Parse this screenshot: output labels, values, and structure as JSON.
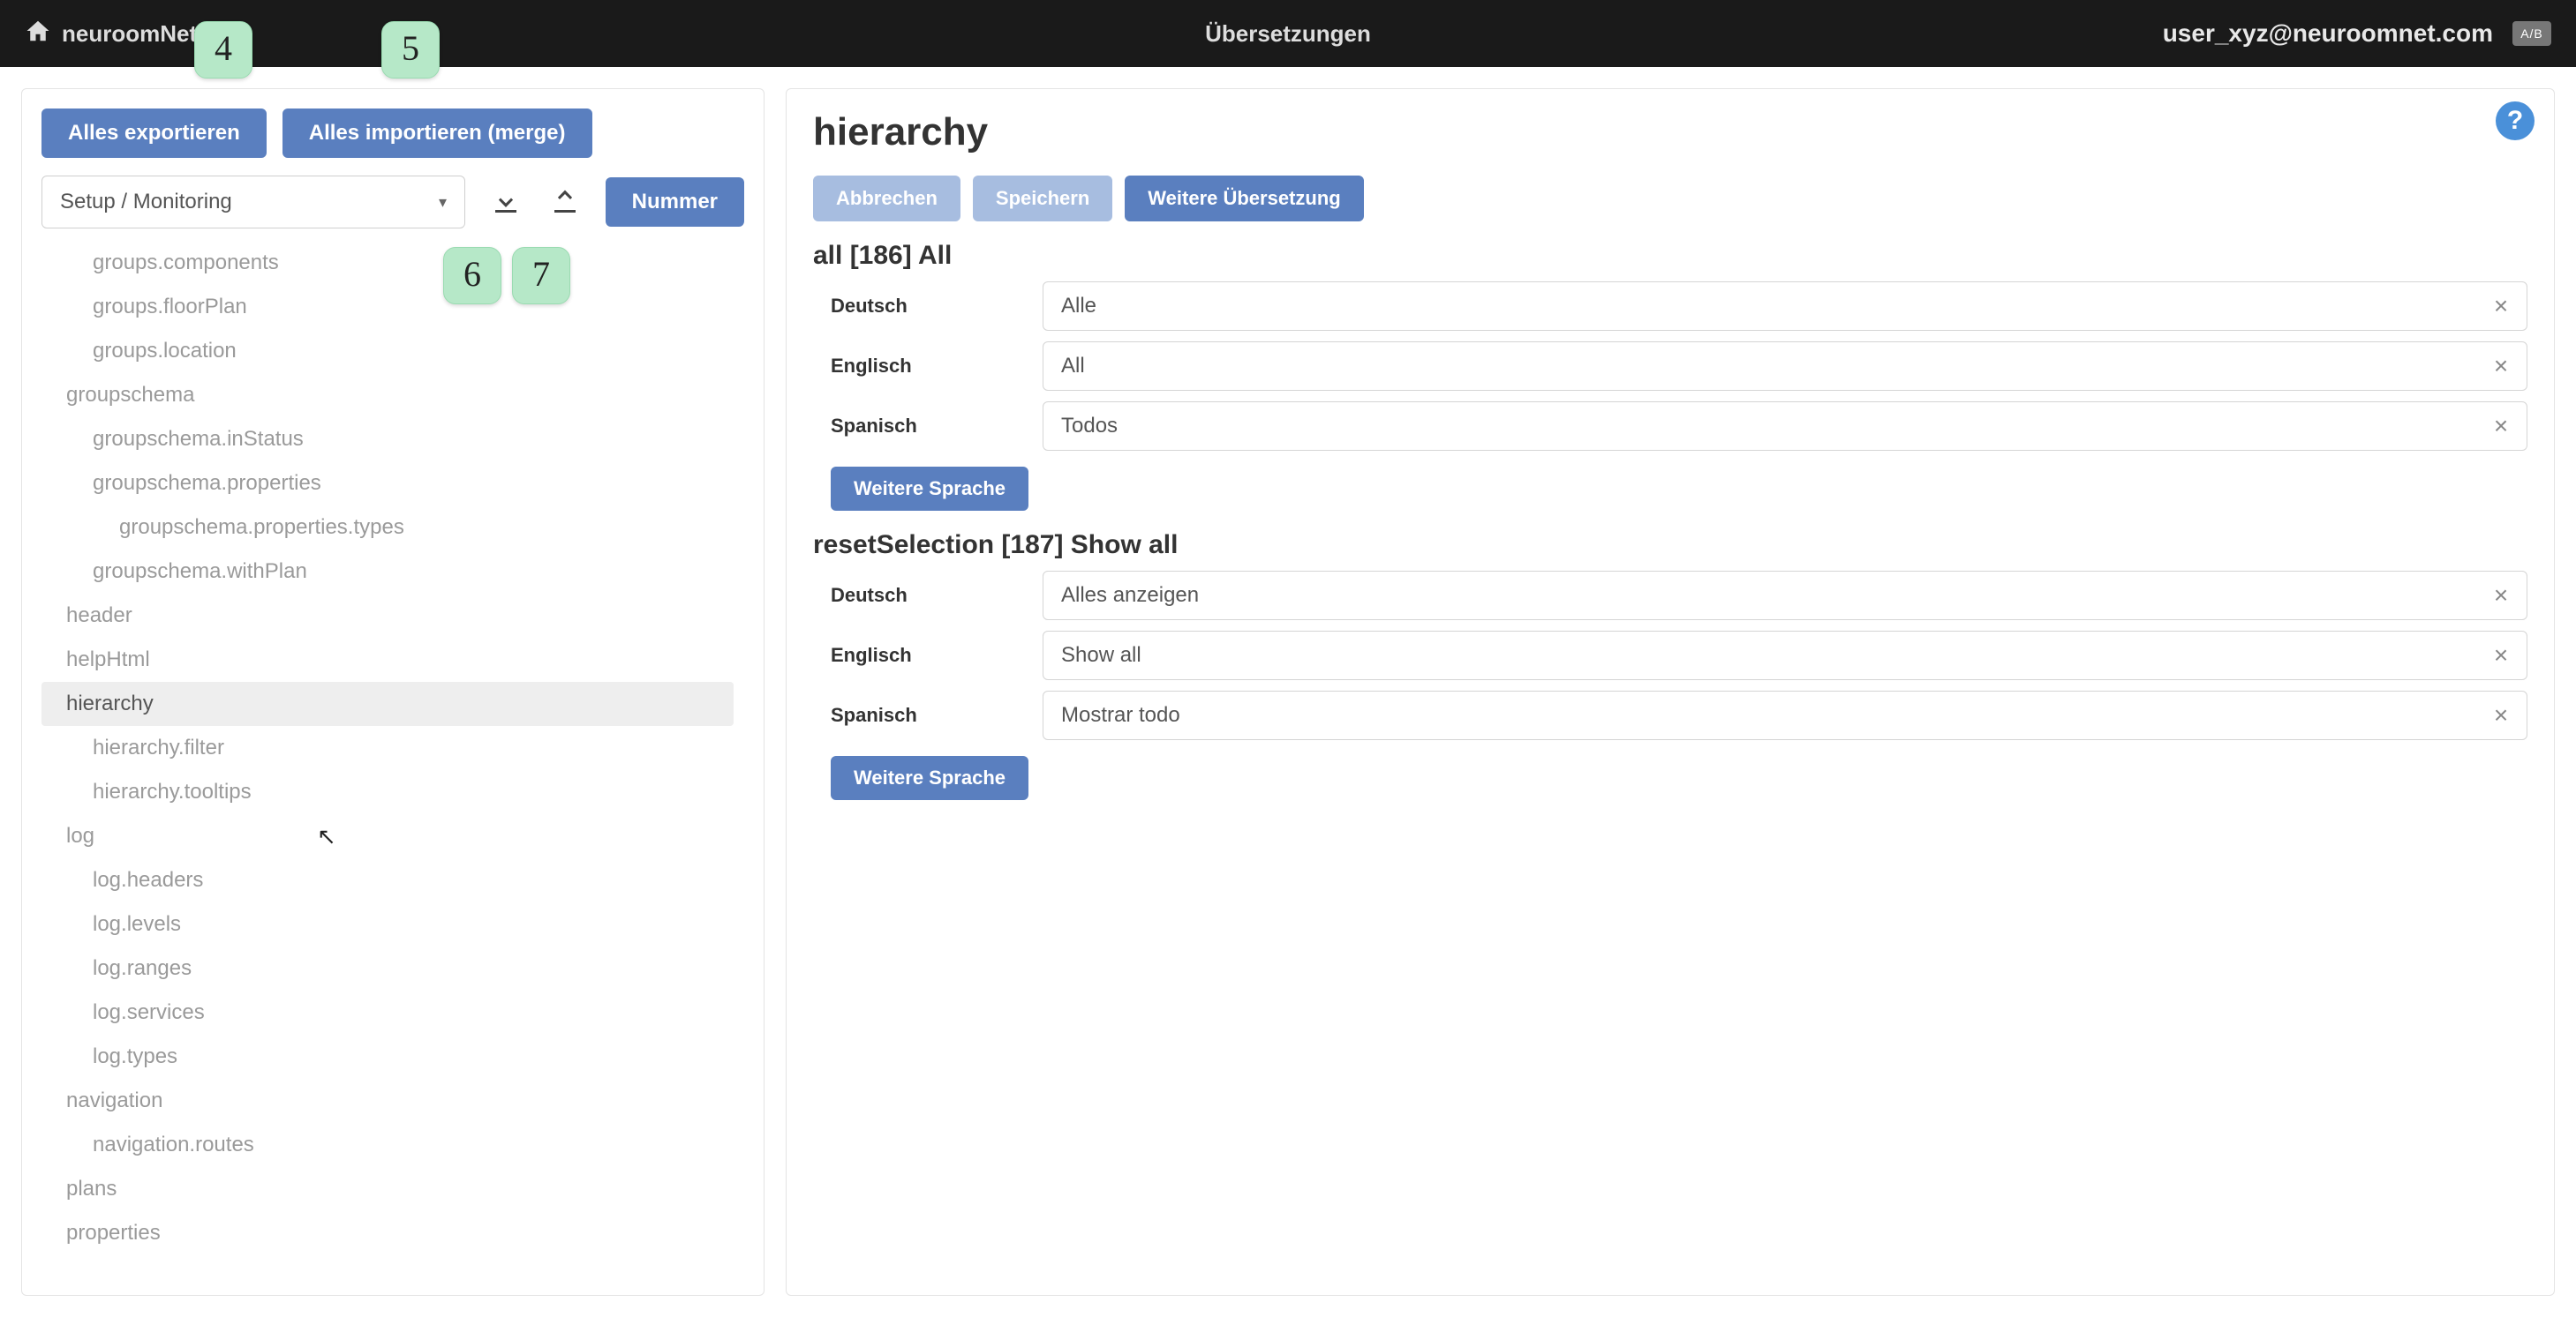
{
  "topbar": {
    "brand": "neuroomNet",
    "page_title": "Übersetzungen",
    "user_email": "user_xyz@neuroomnet.com",
    "lang_badge": "A/B"
  },
  "left": {
    "export_all": "Alles exportieren",
    "import_all": "Alles importieren (merge)",
    "dropdown_value": "Setup / Monitoring",
    "number_btn": "Nummer",
    "tree": [
      {
        "label": "groups.components",
        "level": 1,
        "active": false
      },
      {
        "label": "groups.floorPlan",
        "level": 1,
        "active": false
      },
      {
        "label": "groups.location",
        "level": 1,
        "active": false
      },
      {
        "label": "groupschema",
        "level": 0,
        "active": false
      },
      {
        "label": "groupschema.inStatus",
        "level": 1,
        "active": false
      },
      {
        "label": "groupschema.properties",
        "level": 1,
        "active": false
      },
      {
        "label": "groupschema.properties.types",
        "level": 2,
        "active": false
      },
      {
        "label": "groupschema.withPlan",
        "level": 1,
        "active": false
      },
      {
        "label": "header",
        "level": 0,
        "active": false
      },
      {
        "label": "helpHtml",
        "level": 0,
        "active": false
      },
      {
        "label": "hierarchy",
        "level": 0,
        "active": true
      },
      {
        "label": "hierarchy.filter",
        "level": 1,
        "active": false
      },
      {
        "label": "hierarchy.tooltips",
        "level": 1,
        "active": false
      },
      {
        "label": "log",
        "level": 0,
        "active": false
      },
      {
        "label": "log.headers",
        "level": 1,
        "active": false
      },
      {
        "label": "log.levels",
        "level": 1,
        "active": false
      },
      {
        "label": "log.ranges",
        "level": 1,
        "active": false
      },
      {
        "label": "log.services",
        "level": 1,
        "active": false
      },
      {
        "label": "log.types",
        "level": 1,
        "active": false
      },
      {
        "label": "navigation",
        "level": 0,
        "active": false
      },
      {
        "label": "navigation.routes",
        "level": 1,
        "active": false
      },
      {
        "label": "plans",
        "level": 0,
        "active": false
      },
      {
        "label": "properties",
        "level": 0,
        "active": false
      }
    ]
  },
  "right": {
    "title": "hierarchy",
    "actions": {
      "cancel": "Abbrechen",
      "save": "Speichern",
      "more": "Weitere Übersetzung"
    },
    "add_language": "Weitere Sprache",
    "sections": [
      {
        "heading": "all [186] All",
        "rows": [
          {
            "lang": "Deutsch",
            "value": "Alle"
          },
          {
            "lang": "Englisch",
            "value": "All"
          },
          {
            "lang": "Spanisch",
            "value": "Todos"
          }
        ]
      },
      {
        "heading": "resetSelection [187] Show all",
        "rows": [
          {
            "lang": "Deutsch",
            "value": "Alles anzeigen"
          },
          {
            "lang": "Englisch",
            "value": "Show all"
          },
          {
            "lang": "Spanisch",
            "value": "Mostrar todo"
          }
        ]
      }
    ]
  },
  "markers": {
    "m4": "4",
    "m5": "5",
    "m6": "6",
    "m7": "7"
  }
}
